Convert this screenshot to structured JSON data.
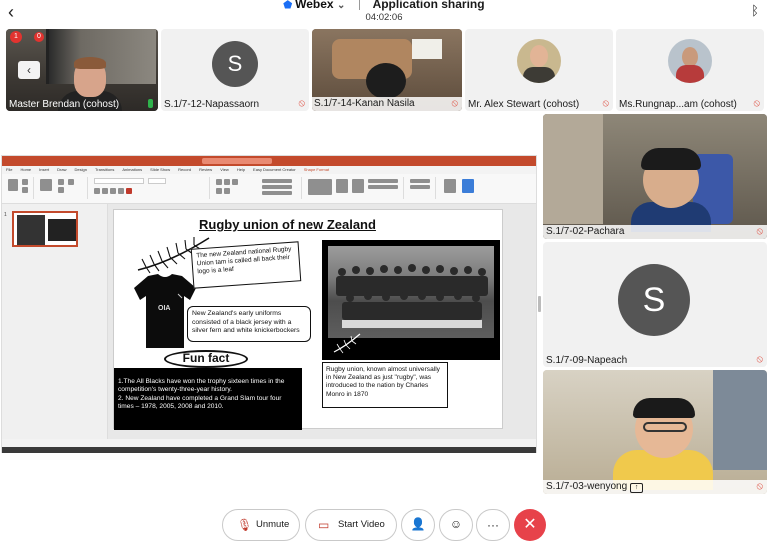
{
  "header": {
    "app_name": "Webex",
    "dropdown_glyph": "⌄",
    "shield_glyph": "⬟",
    "mode_title": "Application sharing",
    "timer": "04:02:06",
    "back_glyph": "‹",
    "bluetooth_glyph": "ᛒ"
  },
  "top_participants": [
    {
      "name": "Master Brendan (cohost)",
      "mic": "active"
    },
    {
      "name": "S.1/7-12-Napassaorn",
      "avatar_letter": "S",
      "mic": "muted"
    },
    {
      "name": "S.1/7-14-Kanan Nasila",
      "mic": "muted"
    },
    {
      "name": "Mr. Alex Stewart (cohost)",
      "mic": "muted"
    },
    {
      "name": "Ms.Rungnap...am (cohost)",
      "mic": "muted"
    }
  ],
  "tile_badges": {
    "badge1": "1",
    "badge2": "0",
    "collapse_glyph": "‹"
  },
  "mic_muted_glyph": "🎙",
  "slide": {
    "title": "Rugby union of new Zealand",
    "bubble1": "The new Zealand national Rugby Union tam is called all back their logo is a leaf",
    "bubble2": "New Zealand's early uniforms consisted of a black jersey with a silver fern and white knickerbockers",
    "fun_fact_heading": "Fun fact",
    "fun_fact_text": "1.The All Blacks have won the trophy sixteen times in the competition's twenty-three-year history.\n2. New Zealand have completed a Grand Slam tour four times – 1978, 2005, 2008 and 2010.",
    "caption": "Rugby union, known almost universally in New Zealand as just \"rugby\", was introduced to the nation by Charles Monro in 1870"
  },
  "ppt_tabs": [
    "File",
    "Home",
    "Insert",
    "Draw",
    "Design",
    "Transitions",
    "Animations",
    "Slide Show",
    "Record",
    "Review",
    "View",
    "Help",
    "Easy Document Creator",
    "Shape Format"
  ],
  "right_participants": [
    {
      "name": "S.1/7-02-Pachara",
      "mic": "muted"
    },
    {
      "name": "S.1/7-09-Napeach",
      "avatar_letter": "S",
      "mic": "muted"
    },
    {
      "name": "S.1/7-03-wenyong",
      "mic": "muted",
      "sharing_badge": "↑"
    }
  ],
  "controls": {
    "unmute_label": "Unmute",
    "start_video_label": "Start Video",
    "mic_off_glyph": "🎙",
    "video_off_glyph": "▭",
    "participants_glyph": "👤",
    "reactions_glyph": "☺",
    "more_glyph": "···",
    "leave_glyph": "✕"
  },
  "colors": {
    "leave_red": "#e7424a",
    "muted_red": "#e0574a",
    "ppt_brand": "#c34a2c",
    "webex_blue": "#1a6ef5"
  }
}
